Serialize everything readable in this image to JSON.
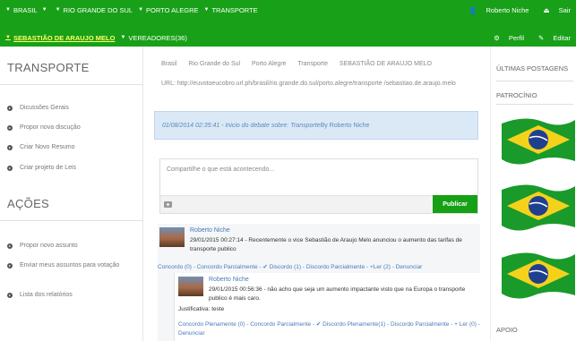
{
  "topbar": {
    "breadcrumbs": [
      "BRASIL",
      "RIO GRANDE DO SUL",
      "PORTO ALEGRE",
      "TRANSPORTE"
    ],
    "user_name": "Roberto Niche",
    "logout": "Sair",
    "candidate": "SEBASTIÃO DE ARAUJO MELO",
    "vereadores": "VEREADORES(36)",
    "profile": "Perfil",
    "edit": "Editar"
  },
  "left": {
    "title": "TRANSPORTE",
    "menu": [
      "Dicussões Gerais",
      "Propor nova discução",
      "Criar Novo Resumo",
      "Criar projeto de Leis"
    ],
    "actions_title": "AÇÕES",
    "actions": [
      "Propor novo assunto",
      "Enviar meus assuntos para votação",
      "Lista dos relatórios"
    ]
  },
  "main": {
    "breadcrumb": [
      "Brasil",
      "Rio Grande do Sul",
      "Porto Alegre",
      "Transporte",
      "SEBASTIÃO DE ARAUJO MELO"
    ],
    "url": "URL: http://euvotoeucobro.url.ph/brasil/rio.grande.do.sul/porto.alegre/transporte /sebastiao.de.araujo.melo",
    "notice_italic": "01/08/2014 02:35:41 - Inicio do debate sobre: Transporte",
    "notice_author": " By Roberto Niche",
    "composer_placeholder": "Compartilhe o que está acontecendo...",
    "publish": "Publicar",
    "post": {
      "author": "Roberto Niche",
      "text": "29/01/2015 00:27:14 - Recentemente o vice Sebastião de Araujo Melo anunciou o aumento das tarifas de transporte publico",
      "actions": "Concordo (0) - Concordo Parcialmente - ✔ Discordo (1) - Discordo Parcialmente - +Ler (2) - Denunciar"
    },
    "reply": {
      "author": "Roberto Niche",
      "text": "29/01/2015 00:56:36 - não acho que seja um aumento impactante visto que na Europa o transporte publico é mais caro.",
      "justification": "Justificativa: teste",
      "actions_line1": "Concordo Plenamente (0) - Concordo Parcialmente - ✔ Discordo Plenamente(1) - Discordo Parcialmente - + Ler (0) -",
      "actions_line2": "Denunciar"
    }
  },
  "right": {
    "latest": "ÚLTIMAS POSTAGENS",
    "sponsor": "PATROCÍNIO",
    "support": "APOIO"
  },
  "colors": {
    "topbar": "#18a018",
    "active_link": "#ffff66",
    "notice_bg": "#dbe9f7",
    "link": "#4a7ab8"
  }
}
